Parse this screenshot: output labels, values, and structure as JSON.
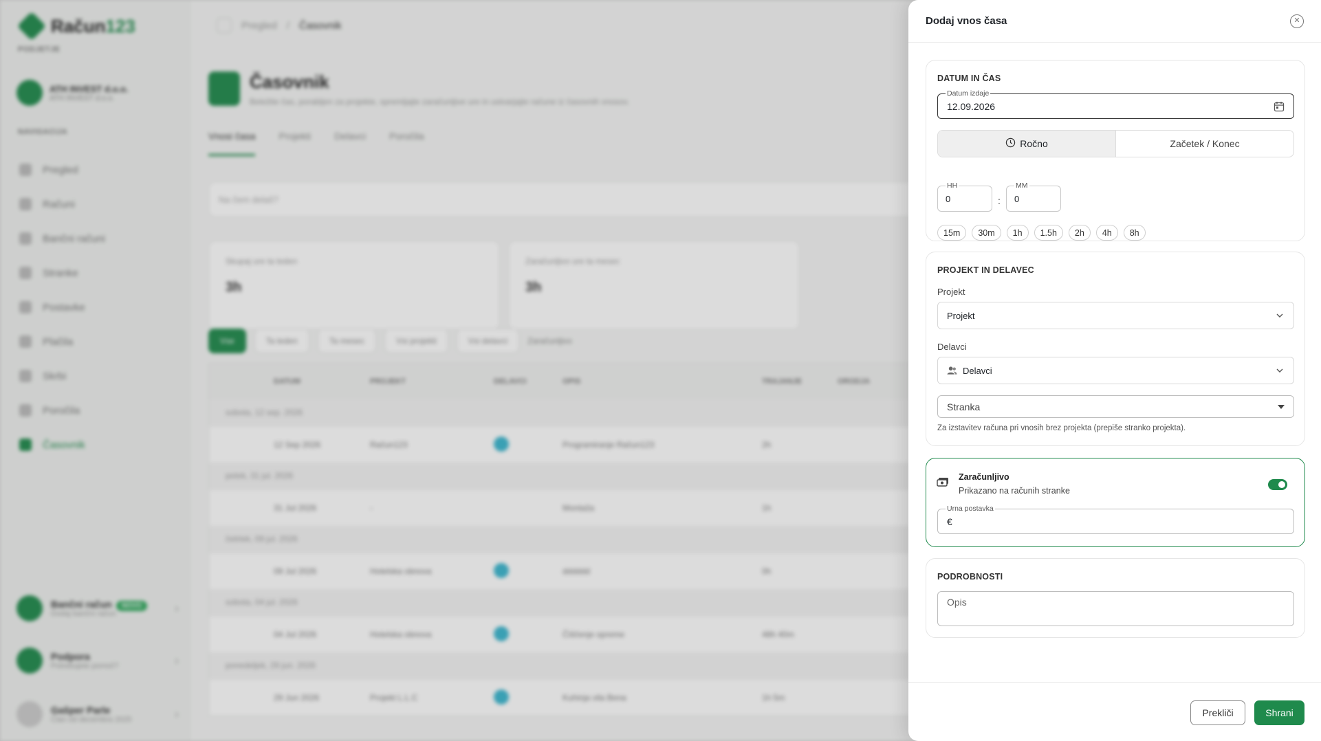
{
  "background": {
    "logo": {
      "text_a": "Račun",
      "text_b": "123"
    },
    "sidebar": {
      "company_section": "PODJETJE",
      "company_name": "ATH INVEST d.o.o.",
      "company_sub": "ATH INVEST d.o.o.",
      "nav_section": "NAVIGACIJA",
      "items": [
        {
          "label": "Pregled"
        },
        {
          "label": "Računi"
        },
        {
          "label": "Bančni računi"
        },
        {
          "label": "Stranke"
        },
        {
          "label": "Postavke"
        },
        {
          "label": "Plačila"
        },
        {
          "label": "Skrbi"
        },
        {
          "label": "Poročila"
        },
        {
          "label": "Časovnik"
        }
      ],
      "bottom": [
        {
          "title": "Bančni račun",
          "badge": "NOVO",
          "sub": "Dodaj bančni račun"
        },
        {
          "title": "Podpora",
          "sub": "Potrebujete pomoč?"
        },
        {
          "title": "Gašper Parle",
          "sub": "Član od decembra 2025"
        }
      ]
    },
    "breadcrumb": [
      "Pregled",
      "Časovnik"
    ],
    "page": {
      "title": "Časovnik",
      "subtitle": "Beležite čas, porabljen za projekte, spremljajte zaračunljive ure in ustvarjajte račune iz časovnih vnosov."
    },
    "tabs": [
      "Vnosi časa",
      "Projekti",
      "Delavci",
      "Poročila"
    ],
    "search_placeholder": "Na čem delaš?",
    "cards": [
      {
        "label": "Skupaj ure ta teden",
        "value": "3h"
      },
      {
        "label": "Zaračunljivo ure ta mesec",
        "value": "3h"
      }
    ],
    "filters": [
      "Vse",
      "Ta teden",
      "Ta mesec",
      "Vsi projekti",
      "Vsi delavci",
      "Zaračunljivo"
    ],
    "table_headers": [
      "DATUM",
      "PROJEKT",
      "DELAVCI",
      "OPIS",
      "TRAJANJE",
      "ORODJA"
    ],
    "groups": [
      {
        "label": "sobota, 12 sep. 2026",
        "row": {
          "date": "12 Sep 2026",
          "project": "Račun123",
          "desc": "Programiranje Račun123",
          "dur": "2h"
        }
      },
      {
        "label": "petek, 31 jul. 2026",
        "row": {
          "date": "31 Jul 2026",
          "project": "-",
          "desc": "Montaža",
          "dur": "1h"
        }
      },
      {
        "label": "četrtek, 09 jul. 2026",
        "row": {
          "date": "09 Jul 2026",
          "project": "Hotelska obnova",
          "desc": "dddddd",
          "dur": "0h"
        }
      },
      {
        "label": "sobota, 04 jul. 2026",
        "row": {
          "date": "04 Jul 2026",
          "project": "Hotelska obnova",
          "desc": "Čiščenje opreme",
          "dur": "48h 40m"
        }
      },
      {
        "label": "ponedeljek, 29 jun. 2026",
        "row": {
          "date": "29 Jun 2026",
          "project": "Projekt L.L.C",
          "desc": "Kuhinja vila Bena",
          "dur": "1h 5m"
        }
      }
    ]
  },
  "drawer": {
    "title": "Dodaj vnos časa",
    "date_section": {
      "title": "DATUM IN ČAS",
      "date_label": "Datum izdaje",
      "date_value": "12.09.2026",
      "mode_manual": "Ročno",
      "mode_range": "Začetek / Konec",
      "hh_label": "HH",
      "hh_value": "0",
      "mm_label": "MM",
      "mm_value": "0",
      "separator": ":",
      "presets": [
        "15m",
        "30m",
        "1h",
        "1.5h",
        "2h",
        "4h",
        "8h"
      ]
    },
    "project_section": {
      "title": "PROJEKT IN DELAVEC",
      "project_label": "Projekt",
      "project_value": "Projekt",
      "workers_label": "Delavci",
      "workers_value": "Delavci",
      "client_value": "Stranka",
      "client_help": "Za izstavitev računa pri vnosih brez projekta (prepiše stranko projekta)."
    },
    "billable": {
      "title": "Zaračunljivo",
      "subtitle": "Prikazano na računih stranke",
      "enabled": true,
      "rate_label": "Urna postavka",
      "currency": "€"
    },
    "details": {
      "title": "PODROBNOSTI",
      "description_placeholder": "Opis"
    },
    "buttons": {
      "cancel": "Prekliči",
      "save": "Shrani"
    },
    "accent_color": "#1f8a4c"
  }
}
